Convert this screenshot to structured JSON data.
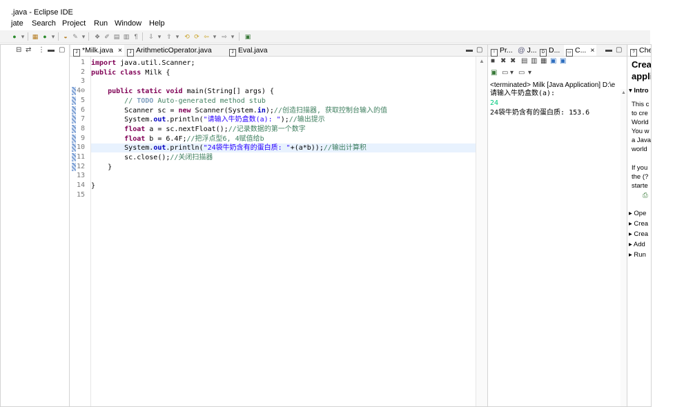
{
  "window": {
    "title": ".java - Eclipse IDE"
  },
  "menu": [
    "jate",
    "Search",
    "Project",
    "Run",
    "Window",
    "Help"
  ],
  "left_panel": {
    "icons": [
      "collapse-icon",
      "link-icon",
      "view-menu-icon",
      "minimize-icon",
      "maximize-icon"
    ]
  },
  "editor": {
    "tabs": [
      {
        "label": "*Milk.java",
        "active": true,
        "close": "×"
      },
      {
        "label": "ArithmeticOperator.java",
        "active": false
      },
      {
        "label": "Eval.java",
        "active": false
      }
    ],
    "current_line": 10,
    "lines": [
      {
        "n": "1",
        "segs": [
          {
            "c": "kw",
            "t": "import"
          },
          {
            "c": "",
            "t": " java.util.Scanner;"
          }
        ]
      },
      {
        "n": "2",
        "segs": [
          {
            "c": "kw",
            "t": "public"
          },
          {
            "c": "",
            "t": " "
          },
          {
            "c": "kw",
            "t": "class"
          },
          {
            "c": "",
            "t": " Milk {"
          }
        ]
      },
      {
        "n": "3",
        "segs": []
      },
      {
        "n": "4⊖",
        "segs": [
          {
            "c": "",
            "t": "    "
          },
          {
            "c": "kw",
            "t": "public"
          },
          {
            "c": "",
            "t": " "
          },
          {
            "c": "kw",
            "t": "static"
          },
          {
            "c": "",
            "t": " "
          },
          {
            "c": "kw",
            "t": "void"
          },
          {
            "c": "",
            "t": " main(String[] args) {"
          }
        ]
      },
      {
        "n": "5",
        "segs": [
          {
            "c": "",
            "t": "        "
          },
          {
            "c": "cm",
            "t": "// "
          },
          {
            "c": "todo",
            "t": "TODO"
          },
          {
            "c": "cm",
            "t": " Auto-generated method stub"
          }
        ]
      },
      {
        "n": "6",
        "segs": [
          {
            "c": "",
            "t": "        Scanner sc = "
          },
          {
            "c": "kw",
            "t": "new"
          },
          {
            "c": "",
            "t": " Scanner(System."
          },
          {
            "c": "fd",
            "t": "in"
          },
          {
            "c": "",
            "t": ");"
          },
          {
            "c": "cm",
            "t": "//创造扫描器, 获取控制台输入的值"
          }
        ]
      },
      {
        "n": "7",
        "segs": [
          {
            "c": "",
            "t": "        System."
          },
          {
            "c": "fd",
            "t": "out"
          },
          {
            "c": "",
            "t": ".println("
          },
          {
            "c": "st",
            "t": "\"请输入牛奶盒数(a): \""
          },
          {
            "c": "",
            "t": ");"
          },
          {
            "c": "cm",
            "t": "//输出提示"
          }
        ]
      },
      {
        "n": "8",
        "segs": [
          {
            "c": "",
            "t": "        "
          },
          {
            "c": "kw",
            "t": "float"
          },
          {
            "c": "",
            "t": " a = sc.nextFloat();"
          },
          {
            "c": "cm",
            "t": "//记录数据的第一个数字"
          }
        ]
      },
      {
        "n": "9",
        "segs": [
          {
            "c": "",
            "t": "        "
          },
          {
            "c": "kw",
            "t": "float"
          },
          {
            "c": "",
            "t": " b = 6.4F;"
          },
          {
            "c": "cm",
            "t": "//把浮点型6, 4赋值给b"
          }
        ]
      },
      {
        "n": "10",
        "segs": [
          {
            "c": "",
            "t": "        System."
          },
          {
            "c": "fd",
            "t": "out"
          },
          {
            "c": "",
            "t": ".println("
          },
          {
            "c": "st",
            "t": "\"24袋牛奶含有的蛋白质: \""
          },
          {
            "c": "",
            "t": "+(a*b));"
          },
          {
            "c": "cm",
            "t": "//输出计算积"
          }
        ]
      },
      {
        "n": "11",
        "segs": [
          {
            "c": "",
            "t": "        sc.close();"
          },
          {
            "c": "cm",
            "t": "//关闭扫描器"
          }
        ]
      },
      {
        "n": "12",
        "segs": [
          {
            "c": "",
            "t": "    }"
          }
        ]
      },
      {
        "n": "13",
        "segs": []
      },
      {
        "n": "14",
        "segs": [
          {
            "c": "",
            "t": "}"
          }
        ]
      },
      {
        "n": "15",
        "segs": []
      }
    ]
  },
  "console": {
    "tabs": [
      "Pr...",
      "J...",
      "D...",
      "C..."
    ],
    "close": "×",
    "status": "<terminated> Milk [Java Application] D:\\e",
    "output": [
      {
        "text": "请输入牛奶盒数(a):",
        "color": "#000000"
      },
      {
        "text": "24",
        "color": "#00c87d"
      },
      {
        "text": "24袋牛奶含有的蛋白质: 153.6",
        "color": "#000000"
      }
    ]
  },
  "cheatsheet": {
    "tab": "Che",
    "title_lines": [
      "Crea",
      "appli"
    ],
    "section": "Intro",
    "intro_lines": [
      "This c",
      "to cre",
      "World",
      "You w",
      "a Java",
      "world"
    ],
    "help_lines": [
      "If you",
      "the (?",
      "starte"
    ],
    "steps": [
      "Ope",
      "Crea",
      "Crea",
      "Add",
      "Run"
    ]
  }
}
